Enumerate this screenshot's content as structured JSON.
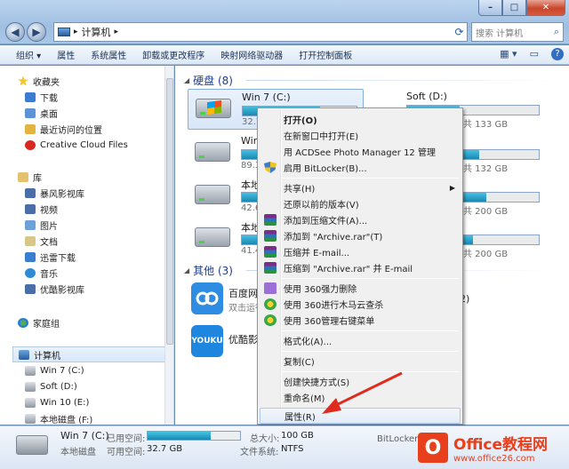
{
  "window": {
    "minimize": "–",
    "maximize": "□",
    "close": "✕"
  },
  "address": {
    "back": "◀",
    "forward": "▶",
    "path": "计算机",
    "sep": "▸",
    "refresh": "⟳",
    "search_placeholder": "搜索 计算机"
  },
  "toolbar": {
    "items": [
      "组织 ▾",
      "属性",
      "系统属性",
      "卸载或更改程序",
      "映射网络驱动器",
      "打开控制面板"
    ]
  },
  "nav": {
    "favorites": "收藏夹",
    "downloads": "下载",
    "desktop": "桌面",
    "recent": "最近访问的位置",
    "creative_cloud": "Creative Cloud Files",
    "libraries": "库",
    "baofeng": "暴风影视库",
    "video": "视频",
    "pictures": "图片",
    "documents": "文档",
    "xunlei": "迅雷下载",
    "music": "音乐",
    "youku": "优酷影视库",
    "homegroup": "家庭组",
    "computer": "计算机",
    "drive_c": "Win 7 (C:)",
    "drive_d": "Soft (D:)",
    "drive_e": "Win 10 (E:)",
    "drive_f": "本地磁盘 (F:)"
  },
  "content": {
    "hdd_header": "硬盘 (8)",
    "other_header": "其他 (3)",
    "drives": [
      {
        "name": "Win 7 (C:)",
        "size": "32.7 GB",
        "usage": 0.68
      },
      {
        "name": "Win 10",
        "size": "89.3 GB",
        "usage": 0.3
      },
      {
        "name": "本地磁盘",
        "size": "42.6 GB",
        "usage": 0.75
      },
      {
        "name": "本地磁盘",
        "size": "41.4 GB",
        "usage": 0.8
      }
    ],
    "right_drives": [
      {
        "name": "Soft (D:)",
        "size": "共 133 GB",
        "usage": 0.4
      },
      {
        "size": "共 132 GB",
        "usage": 0.55
      },
      {
        "size": "共 200 GB",
        "usage": 0.6
      },
      {
        "size": "共 200 GB",
        "usage": 0.5
      }
    ],
    "baidu_name": "百度网盘",
    "baidu_sub": "双击运行",
    "baidu_right": "2)",
    "youku_name": "优酷影视"
  },
  "menu": {
    "open": "打开(O)",
    "open_new_window": "在新窗口中打开(E)",
    "acdsee": "用 ACDSee Photo Manager 12 管理",
    "bitlocker": "启用 BitLocker(B)...",
    "share": "共享(H)",
    "restore": "还原以前的版本(V)",
    "add_archive": "添加到压缩文件(A)...",
    "add_rar": "添加到 \"Archive.rar\"(T)",
    "compress_email": "压缩并 E-mail...",
    "compress_rar_email": "压缩到 \"Archive.rar\" 并 E-mail",
    "delete_360": "使用 360强力删除",
    "scan_360": "使用 360进行木马云查杀",
    "manage_360": "使用 360管理右键菜单",
    "format": "格式化(A)...",
    "copy": "复制(C)",
    "shortcut": "创建快捷方式(S)",
    "rename": "重命名(M)",
    "properties": "属性(R)"
  },
  "details": {
    "name": "Win 7 (C:)",
    "type": "本地磁盘",
    "used_label": "已用空间:",
    "free_label": "可用空间:",
    "free_value": "32.7 GB",
    "total_label": "总大小:",
    "total_value": "100 GB",
    "fs_label": "文件系统:",
    "fs_value": "NTFS",
    "bitlocker": "BitLocker 状",
    "usage": 0.68
  },
  "watermark": {
    "title": "Office教程网",
    "url": "www.office26.com"
  },
  "colors": {
    "accent": "#1e3d8f",
    "watermark": "#e8401c",
    "bar_fill": "#1a88b2"
  }
}
